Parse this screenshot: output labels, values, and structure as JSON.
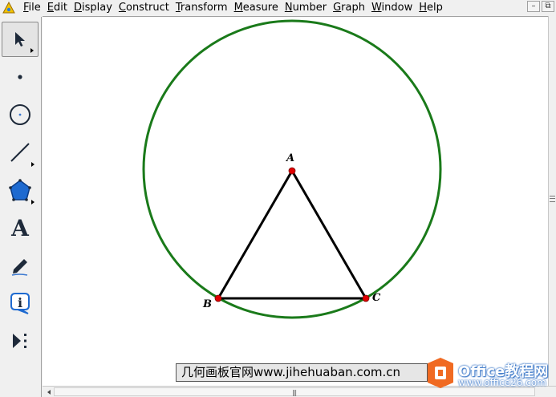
{
  "menubar": {
    "items": [
      {
        "first": "F",
        "rest": "ile"
      },
      {
        "first": "E",
        "rest": "dit"
      },
      {
        "first": "D",
        "rest": "isplay"
      },
      {
        "first": "C",
        "rest": "onstruct"
      },
      {
        "first": "T",
        "rest": "ransform"
      },
      {
        "first": "M",
        "rest": "easure"
      },
      {
        "first": "N",
        "rest": "umber"
      },
      {
        "first": "G",
        "rest": "raph"
      },
      {
        "first": "W",
        "rest": "indow"
      },
      {
        "first": "H",
        "rest": "elp"
      }
    ],
    "minimize_glyph": "–",
    "restore_glyph": "⧉"
  },
  "toolbox": {
    "tools": [
      {
        "name": "arrow-tool",
        "icon": "arrow-pointer-icon",
        "selected": true
      },
      {
        "name": "point-tool",
        "icon": "point-icon"
      },
      {
        "name": "compass-tool",
        "icon": "compass-circle-icon"
      },
      {
        "name": "straightedge-tool",
        "icon": "line-segment-icon"
      },
      {
        "name": "polygon-tool",
        "icon": "pentagon-icon"
      },
      {
        "name": "text-tool",
        "icon": "text-a-icon",
        "glyph": "A"
      },
      {
        "name": "marker-tool",
        "icon": "pen-icon"
      },
      {
        "name": "information-tool",
        "icon": "info-icon",
        "glyph": "i"
      },
      {
        "name": "custom-tool",
        "icon": "custom-tool-icon"
      }
    ]
  },
  "figure": {
    "points": {
      "A": {
        "label": "A"
      },
      "B": {
        "label": "B"
      },
      "C": {
        "label": "C"
      }
    },
    "colors": {
      "circle": "#1a7a1a",
      "segments": "#000000",
      "points": "#e00000"
    }
  },
  "watermark": {
    "site_text": "几何画板官网www.jihehuaban.com.cn",
    "logo_text": "Office教程网",
    "logo_sub": "www.office26.com"
  }
}
